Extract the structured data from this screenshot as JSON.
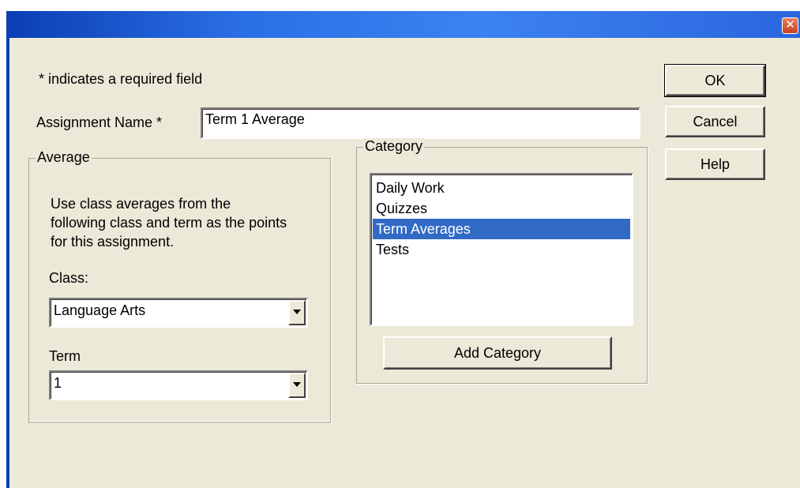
{
  "dialog": {
    "close_label": "✕",
    "required_note": "* indicates a required field",
    "assignment_name_label": "Assignment Name *",
    "assignment_name_value": "Term 1 Average"
  },
  "average_group": {
    "title": "Average",
    "description": "Use class averages from the following class and term as the points for this assignment.",
    "class_label": "Class:",
    "class_value": "Language Arts",
    "term_label": "Term",
    "term_value": "1"
  },
  "category_group": {
    "title": "Category",
    "items": [
      {
        "label": "Daily Work",
        "selected": false
      },
      {
        "label": "Quizzes",
        "selected": false
      },
      {
        "label": "Term Averages",
        "selected": true
      },
      {
        "label": "Tests",
        "selected": false
      }
    ],
    "add_button_label": "Add Category"
  },
  "buttons": {
    "ok_label": "OK",
    "cancel_label": "Cancel",
    "help_label": "Help"
  },
  "colors": {
    "titlebar": "#2b6fe6",
    "dialog_bg": "#ece9d8",
    "selection": "#316ac5"
  }
}
